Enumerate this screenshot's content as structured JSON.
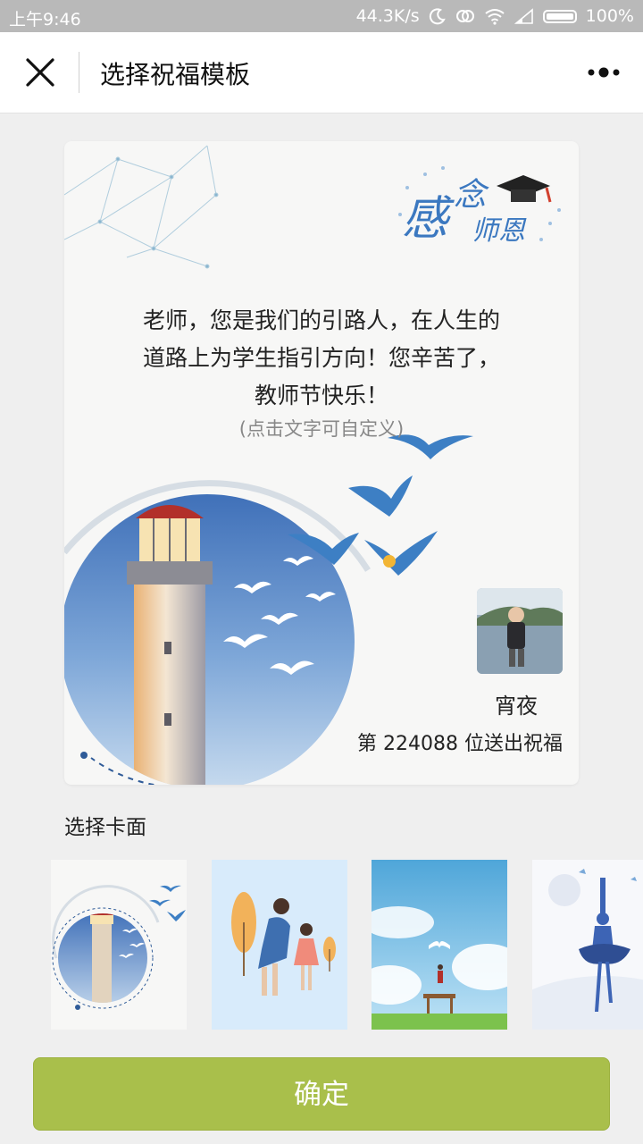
{
  "status_bar": {
    "time": "上午9:46",
    "network_speed": "44.3K/s",
    "battery": "100%",
    "icons": [
      "moon-icon",
      "sync-icon",
      "wifi-icon",
      "signal-icon",
      "battery-icon"
    ]
  },
  "navbar": {
    "title": "选择祝福模板",
    "close_icon": "close-icon",
    "more_icon": "more-dots-icon"
  },
  "card": {
    "badge_text_1": "感",
    "badge_text_2": "念",
    "badge_text_3": "师恩",
    "message": "老师，您是我们的引路人，在人生的道路上为学生指引方向！您辛苦了，教师节快乐！",
    "hint": "(点击文字可自定义)",
    "sender_name": "宵夜",
    "sender_count": "第 224088 位送出祝福",
    "accent_color": "#3d7fc4"
  },
  "section": {
    "label": "选择卡面"
  },
  "templates": [
    {
      "name": "lighthouse-template",
      "selected": true
    },
    {
      "name": "mother-daughter-template",
      "selected": false
    },
    {
      "name": "sky-book-template",
      "selected": false
    },
    {
      "name": "dancer-template",
      "selected": false
    }
  ],
  "confirm": {
    "label": "确定",
    "color": "#a9bf4b"
  }
}
